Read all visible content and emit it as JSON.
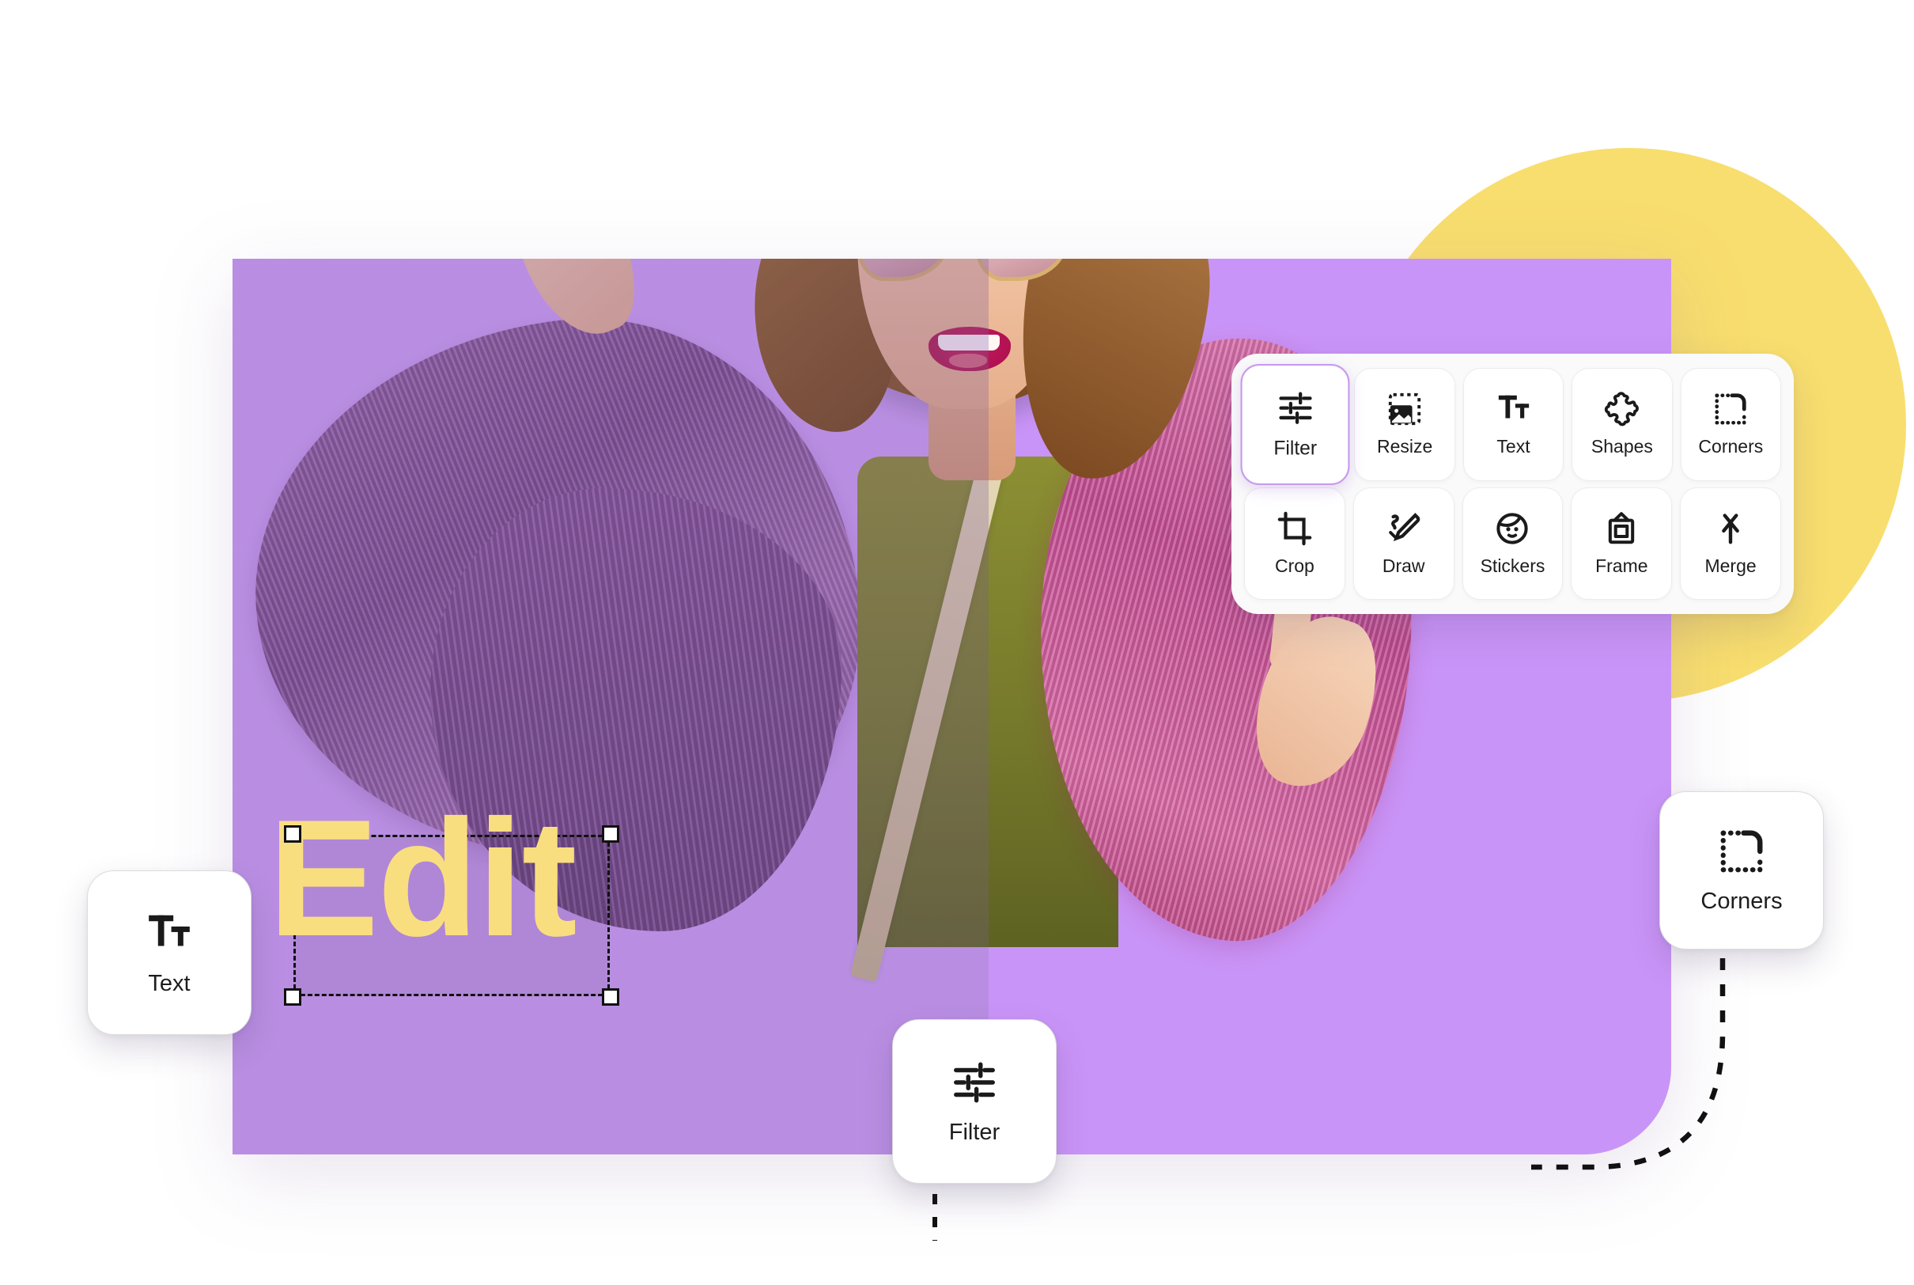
{
  "app": {
    "canvas_background_color": "#C994F7",
    "accent_yellow": "#F8DE6E",
    "active_tool_border_color": "#C79BEE"
  },
  "canvas": {
    "text_object": {
      "value": "Edit",
      "color": "#F9DE80",
      "selected": true,
      "handles": [
        "top-left",
        "top-right",
        "bottom-left",
        "bottom-right"
      ]
    }
  },
  "tool_panel": {
    "rows": [
      [
        {
          "label": "Filter",
          "icon": "sliders-icon",
          "active": true
        },
        {
          "label": "Resize",
          "icon": "resize-image-icon",
          "active": false
        },
        {
          "label": "Text",
          "icon": "text-tt-icon",
          "active": false
        },
        {
          "label": "Shapes",
          "icon": "puzzle-piece-icon",
          "active": false
        },
        {
          "label": "Corners",
          "icon": "rounded-corner-icon",
          "active": false
        }
      ],
      [
        {
          "label": "Crop",
          "icon": "crop-icon",
          "active": false
        },
        {
          "label": "Draw",
          "icon": "pencil-draw-icon",
          "active": false
        },
        {
          "label": "Stickers",
          "icon": "face-sticker-icon",
          "active": false
        },
        {
          "label": "Frame",
          "icon": "picture-frame-icon",
          "active": false
        },
        {
          "label": "Merge",
          "icon": "merge-arrow-icon",
          "active": false
        }
      ]
    ]
  },
  "callouts": {
    "text": {
      "label": "Text",
      "icon": "text-tt-icon"
    },
    "filter": {
      "label": "Filter",
      "icon": "sliders-icon"
    },
    "corners": {
      "label": "Corners",
      "icon": "rounded-corner-icon"
    }
  }
}
